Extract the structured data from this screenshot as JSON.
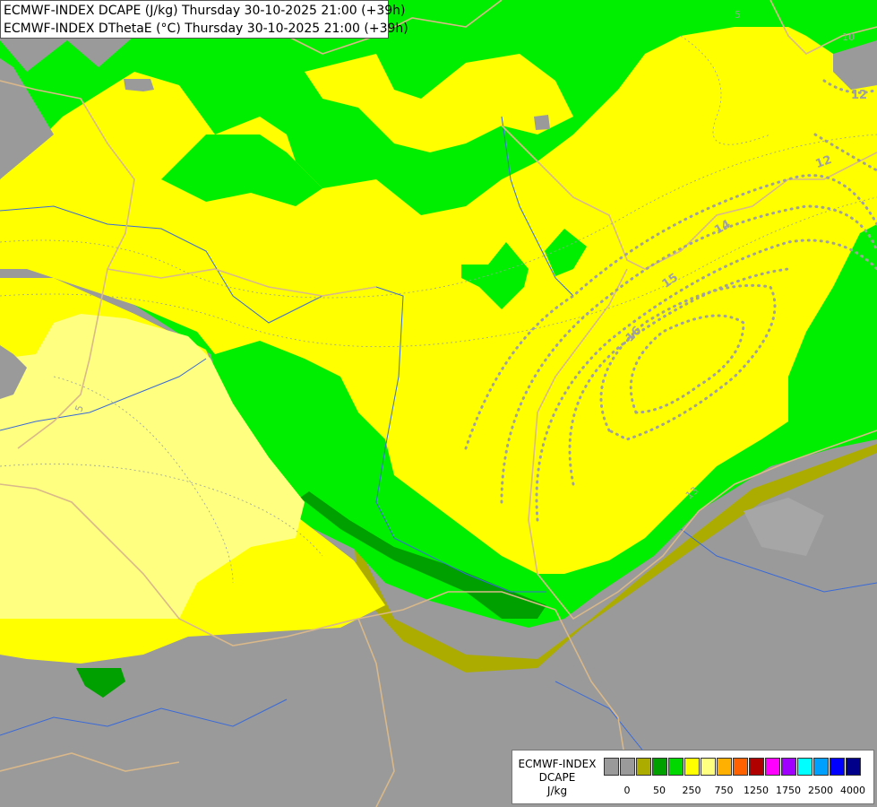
{
  "header": {
    "line1": "ECMWF-INDEX DCAPE (J/kg) Thursday 30-10-2025 21:00 (+39h)",
    "line2": "ECMWF-INDEX DThetaE (°C) Thursday 30-10-2025 21:00 (+39h)"
  },
  "legend": {
    "model": "ECMWF-INDEX",
    "variable": "DCAPE",
    "unit": "J/kg",
    "swatch_colors": [
      "#9a9a9a",
      "#9a9a9a",
      "#acac00",
      "#00a000",
      "#00d800",
      "#ffff00",
      "#ffff80",
      "#ffb000",
      "#ff6000",
      "#b00000",
      "#ff00ff",
      "#a000ff",
      "#00ffff",
      "#00a0ff",
      "#0000ff",
      "#00008a"
    ],
    "tick_labels": [
      "0",
      "50",
      "250",
      "750",
      "1250",
      "1750",
      "2500",
      "4000"
    ]
  },
  "contours": {
    "labels": [
      "5",
      "5",
      "10",
      "12",
      "12",
      "14",
      "15",
      "16",
      "13"
    ]
  },
  "colors": {
    "no_data": "#9a9a9a",
    "olive": "#acac00",
    "dark_green": "#00a000",
    "green": "#00d800",
    "bright_green": "#00ff00",
    "yellow": "#ffff00",
    "light_yellow": "#ffff80"
  }
}
